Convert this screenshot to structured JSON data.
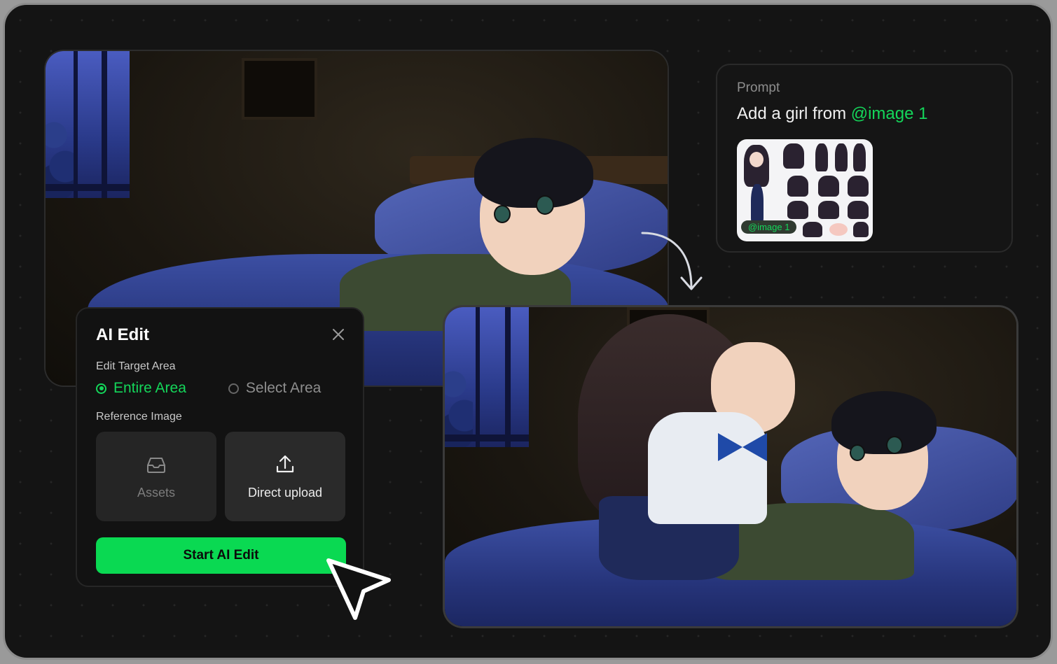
{
  "prompt": {
    "label": "Prompt",
    "text_prefix": "Add a girl from ",
    "text_tag": "@image 1",
    "reference_badge": "@image 1"
  },
  "panel": {
    "title": "AI Edit",
    "edit_target_label": "Edit Target Area",
    "options": [
      {
        "label": "Entire Area",
        "selected": true
      },
      {
        "label": "Select Area",
        "selected": false
      }
    ],
    "reference_label": "Reference Image",
    "tiles": [
      {
        "label": "Assets",
        "icon": "inbox-icon"
      },
      {
        "label": "Direct upload",
        "icon": "upload-icon"
      }
    ],
    "start_button": "Start AI Edit"
  },
  "colors": {
    "accent": "#14d65a",
    "button": "#0ad952",
    "background": "#141414"
  }
}
